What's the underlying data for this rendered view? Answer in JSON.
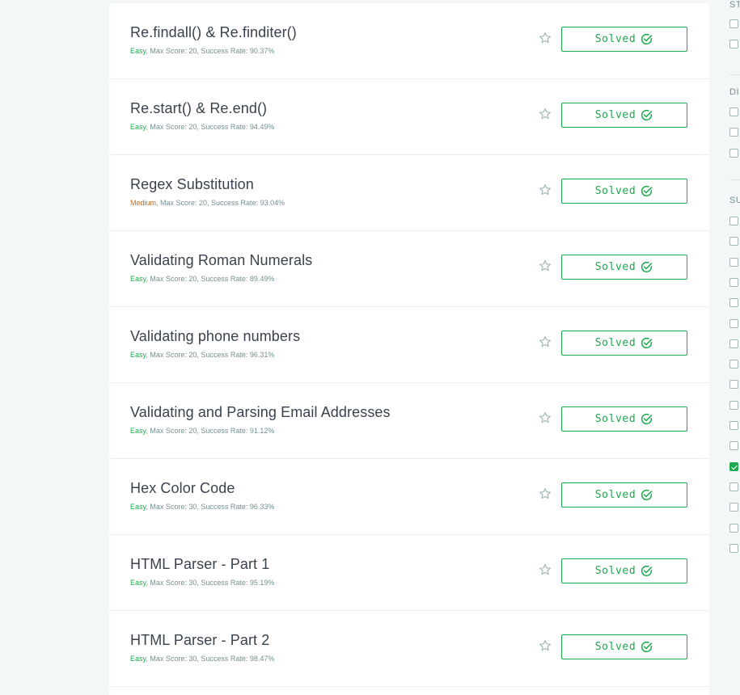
{
  "challenges": [
    {
      "title": "Re.findall() & Re.finditer()",
      "difficulty": "Easy",
      "details": ", Max Score: 20, Success Rate: 90.37%",
      "status": "Solved"
    },
    {
      "title": "Re.start() & Re.end()",
      "difficulty": "Easy",
      "details": ", Max Score: 20, Success Rate: 94.49%",
      "status": "Solved"
    },
    {
      "title": "Regex Substitution",
      "difficulty": "Medium",
      "details": ", Max Score: 20, Success Rate: 93.04%",
      "status": "Solved"
    },
    {
      "title": "Validating Roman Numerals",
      "difficulty": "Easy",
      "details": ", Max Score: 20, Success Rate: 89.49%",
      "status": "Solved"
    },
    {
      "title": "Validating phone numbers",
      "difficulty": "Easy",
      "details": ", Max Score: 20, Success Rate: 96.31%",
      "status": "Solved"
    },
    {
      "title": "Validating and Parsing Email Addresses",
      "difficulty": "Easy",
      "details": ", Max Score: 20, Success Rate: 91.12%",
      "status": "Solved"
    },
    {
      "title": "Hex Color Code",
      "difficulty": "Easy",
      "details": ", Max Score: 30, Success Rate: 96.33%",
      "status": "Solved"
    },
    {
      "title": "HTML Parser - Part 1",
      "difficulty": "Easy",
      "details": ", Max Score: 30, Success Rate: 95.19%",
      "status": "Solved"
    },
    {
      "title": "HTML Parser - Part 2",
      "difficulty": "Easy",
      "details": ", Max Score: 30, Success Rate: 98.47%",
      "status": "Solved"
    }
  ],
  "sidebar": {
    "headings": [
      "ST",
      "DI",
      "SU"
    ],
    "status_checkboxes": [
      false,
      false
    ],
    "difficulty_checkboxes": [
      false,
      false,
      false
    ],
    "subdomain_checkboxes": [
      false,
      false,
      false,
      false,
      false,
      false,
      false,
      false,
      false,
      false,
      false,
      false,
      true,
      false,
      false,
      false,
      false
    ]
  },
  "colors": {
    "accent": "#1ba94c",
    "medium": "#c9691e",
    "title": "#39424e",
    "meta": "#738f93"
  },
  "icons": {
    "favorite": "star-outline-icon",
    "solved": "check-circle-icon"
  }
}
